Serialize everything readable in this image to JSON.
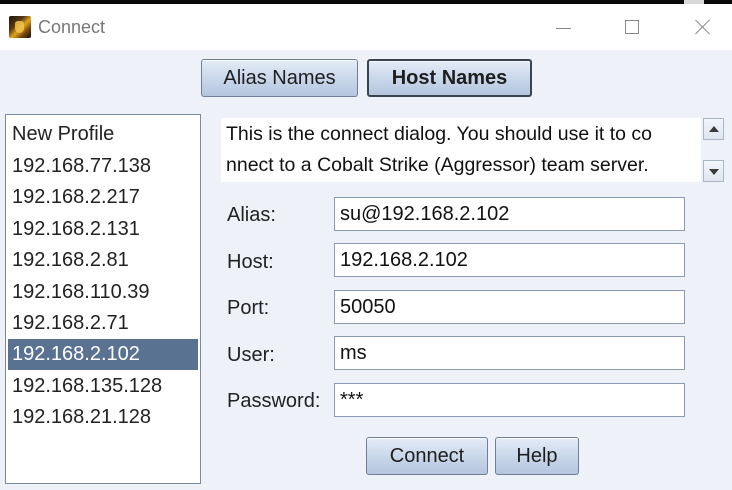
{
  "window": {
    "title": "Connect"
  },
  "tabs": {
    "alias_names": "Alias Names",
    "host_names": "Host Names"
  },
  "profiles": [
    "New Profile",
    "192.168.77.138",
    "192.168.2.217",
    "192.168.2.131",
    "192.168.2.81",
    "192.168.110.39",
    "192.168.2.71",
    "192.168.2.102",
    "192.168.135.128",
    "192.168.21.128"
  ],
  "selected_profile": "192.168.2.102",
  "description": {
    "line1": "This is the connect dialog. You should use it to co",
    "line2": "nnect to a Cobalt Strike (Aggressor) team server."
  },
  "form": {
    "alias_label": "Alias:",
    "alias_value": "su@192.168.2.102",
    "host_label": "Host:",
    "host_value": "192.168.2.102",
    "port_label": "Port:",
    "port_value": "50050",
    "user_label": "User:",
    "user_value": "ms",
    "password_label": "Password:",
    "password_value": "***"
  },
  "buttons": {
    "connect": "Connect",
    "help": "Help"
  },
  "colors": {
    "background": "#eef2f8",
    "selection": "#5a7291",
    "button_top": "#e4ecf7",
    "button_bottom": "#b4c5de"
  }
}
